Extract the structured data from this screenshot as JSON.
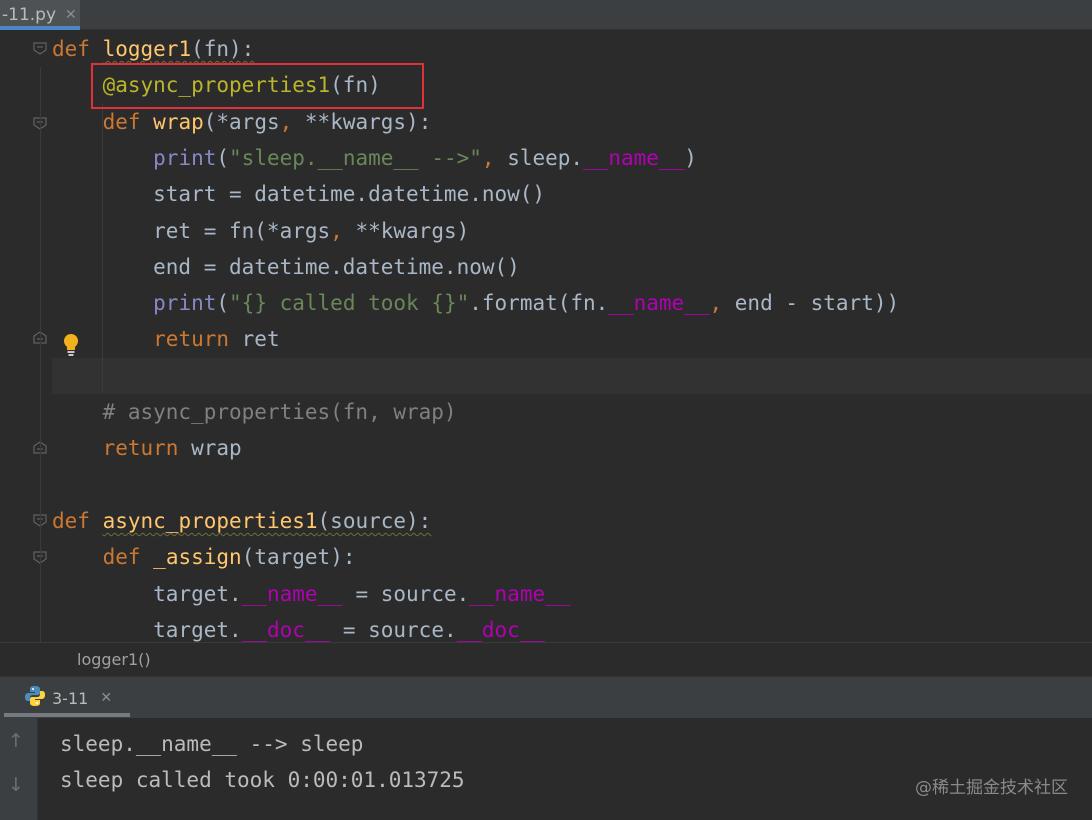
{
  "editor_tab": {
    "label": "-11.py",
    "close": "✕"
  },
  "code_lines": [
    [
      {
        "t": "def",
        "c": "kw"
      },
      {
        "t": " ",
        "c": "plain"
      },
      {
        "t": "logger1",
        "c": "fn squig"
      },
      {
        "t": "(fn):",
        "c": "plain squig"
      }
    ],
    [
      {
        "t": "    ",
        "c": "plain"
      },
      {
        "t": "@async_properties1",
        "c": "dec"
      },
      {
        "t": "(fn)",
        "c": "plain"
      }
    ],
    [
      {
        "t": "    ",
        "c": "plain"
      },
      {
        "t": "def",
        "c": "kw"
      },
      {
        "t": " ",
        "c": "plain"
      },
      {
        "t": "wrap",
        "c": "fn"
      },
      {
        "t": "(*args",
        "c": "plain"
      },
      {
        "t": ",",
        "c": "kw"
      },
      {
        "t": " **kwargs):",
        "c": "plain"
      }
    ],
    [
      {
        "t": "        ",
        "c": "plain"
      },
      {
        "t": "print",
        "c": "builtin"
      },
      {
        "t": "(",
        "c": "plain"
      },
      {
        "t": "\"sleep.__name__ -->\"",
        "c": "str"
      },
      {
        "t": ",",
        "c": "kw"
      },
      {
        "t": " sleep.",
        "c": "plain"
      },
      {
        "t": "__name__",
        "c": "magic"
      },
      {
        "t": ")",
        "c": "plain"
      }
    ],
    [
      {
        "t": "        start = datetime.datetime.now()",
        "c": "plain"
      }
    ],
    [
      {
        "t": "        ret = fn(*args",
        "c": "plain"
      },
      {
        "t": ",",
        "c": "kw"
      },
      {
        "t": " **kwargs)",
        "c": "plain"
      }
    ],
    [
      {
        "t": "        end = datetime.datetime.now()",
        "c": "plain"
      }
    ],
    [
      {
        "t": "        ",
        "c": "plain"
      },
      {
        "t": "print",
        "c": "builtin"
      },
      {
        "t": "(",
        "c": "plain"
      },
      {
        "t": "\"{} called took {}\"",
        "c": "str"
      },
      {
        "t": ".format(fn.",
        "c": "plain"
      },
      {
        "t": "__name__",
        "c": "magic"
      },
      {
        "t": ",",
        "c": "kw"
      },
      {
        "t": " end - start))",
        "c": "plain"
      }
    ],
    [
      {
        "t": "        ",
        "c": "plain"
      },
      {
        "t": "return",
        "c": "kw"
      },
      {
        "t": " ret",
        "c": "plain"
      }
    ],
    [],
    [
      {
        "t": "    # async_properties(fn, wrap)",
        "c": "cm"
      }
    ],
    [
      {
        "t": "    ",
        "c": "plain"
      },
      {
        "t": "return",
        "c": "kw"
      },
      {
        "t": " wrap",
        "c": "plain"
      }
    ],
    [],
    [
      {
        "t": "def",
        "c": "kw"
      },
      {
        "t": " ",
        "c": "plain"
      },
      {
        "t": "async_properties1",
        "c": "fn squig"
      },
      {
        "t": "(source):",
        "c": "plain squig"
      }
    ],
    [
      {
        "t": "    ",
        "c": "plain"
      },
      {
        "t": "def",
        "c": "kw"
      },
      {
        "t": " ",
        "c": "plain"
      },
      {
        "t": "_assign",
        "c": "fn"
      },
      {
        "t": "(target):",
        "c": "plain"
      }
    ],
    [
      {
        "t": "        target.",
        "c": "plain"
      },
      {
        "t": "__name__",
        "c": "magic"
      },
      {
        "t": " = source.",
        "c": "plain"
      },
      {
        "t": "__name__",
        "c": "magic"
      }
    ],
    [
      {
        "t": "        target.",
        "c": "plain"
      },
      {
        "t": "__doc__",
        "c": "magic"
      },
      {
        "t": " = source.",
        "c": "plain"
      },
      {
        "t": "__doc__",
        "c": "magic"
      }
    ]
  ],
  "breadcrumb": "logger1()",
  "run_tab": {
    "label": "3-11",
    "close": "✕"
  },
  "run_toolbar": {
    "up": "↑",
    "down": "↓"
  },
  "output_lines": [
    "sleep.__name__ --> sleep",
    "sleep called took 0:00:01.013725"
  ],
  "watermark": "@稀土掘金技术社区",
  "colors": {
    "highlight_box": "#e0303a",
    "keyword": "#cc7832",
    "function": "#ffc66d",
    "decorator": "#bbb529",
    "string": "#6a8759",
    "magic": "#b200b2"
  }
}
